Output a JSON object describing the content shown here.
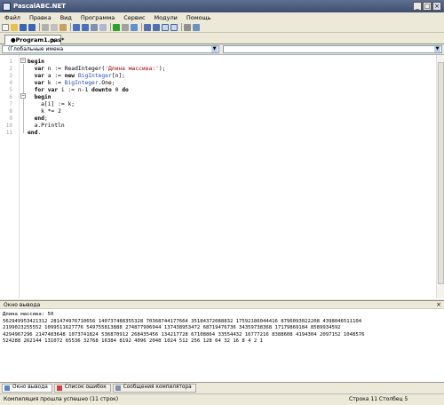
{
  "window": {
    "title": "PascalABC.NET",
    "min": "_",
    "max": "□",
    "close": "×"
  },
  "menu": [
    "Файл",
    "Правка",
    "Вид",
    "Программа",
    "Сервис",
    "Модули",
    "Помощь"
  ],
  "tab": {
    "label": "●Program1.pas*",
    "close": "×"
  },
  "dropdowns": {
    "left": "(Глобальные имена",
    "right": ""
  },
  "editor": {
    "line_numbers": [
      "1",
      "2",
      "3",
      "4",
      "5",
      "6",
      "7",
      "8",
      "9",
      "10",
      "11"
    ],
    "lines": [
      [
        {
          "t": "begin",
          "c": "kw"
        }
      ],
      [
        {
          "t": "  var ",
          "c": "kw"
        },
        {
          "t": "n := ReadInteger(",
          "c": "nm"
        },
        {
          "t": "'Длина массива:'",
          "c": "st"
        },
        {
          "t": ");",
          "c": "nm"
        }
      ],
      [
        {
          "t": "  var ",
          "c": "kw"
        },
        {
          "t": "a := ",
          "c": "nm"
        },
        {
          "t": "new ",
          "c": "kw"
        },
        {
          "t": "BigInteger",
          "c": "ty"
        },
        {
          "t": "[n];",
          "c": "nm"
        }
      ],
      [
        {
          "t": "  var ",
          "c": "kw"
        },
        {
          "t": "k := ",
          "c": "nm"
        },
        {
          "t": "BigInteger",
          "c": "ty"
        },
        {
          "t": ".One;",
          "c": "nm"
        }
      ],
      [
        {
          "t": "  for var ",
          "c": "kw"
        },
        {
          "t": "i := n-1 ",
          "c": "nm"
        },
        {
          "t": "downto ",
          "c": "kw"
        },
        {
          "t": "0 ",
          "c": "nm"
        },
        {
          "t": "do",
          "c": "kw"
        }
      ],
      [
        {
          "t": "  begin",
          "c": "kw"
        }
      ],
      [
        {
          "t": "    a[i] := k;",
          "c": "nm"
        }
      ],
      [
        {
          "t": "    k *= 2",
          "c": "nm"
        }
      ],
      [
        {
          "t": "  end",
          "c": "kw"
        },
        {
          "t": ";",
          "c": "nm"
        }
      ],
      [
        {
          "t": "  a.Println",
          "c": "nm"
        }
      ],
      [
        {
          "t": "end",
          "c": "kw"
        },
        {
          "t": ".",
          "c": "nm"
        }
      ]
    ]
  },
  "output": {
    "header": "Окно вывода",
    "close": "×",
    "text": "Длина массива: 50\n562949953421312 281474976710656 140737488355328 70368744177664 35184372088832 17592186044416 8796093022208 4398046511104\n2199023255552 1099511627776 549755813888 274877906944 137438953472 68719476736 34359738368 17179869184 8589934592\n4294967296 2147483648 1073741824 536870912 268435456 134217728 67108864 33554432 16777216 8388608 4194304 2097152 1048576\n524288 262144 131072 65536 32768 16384 8192 4096 2048 1024 512 256 128 64 32 16 8 4 2 1"
  },
  "bottom_tabs": [
    "Окно вывода",
    "Список ошибок",
    "Сообщения компилятора"
  ],
  "status": {
    "message": "Компиляция прошла успешно (11 строк)",
    "position": "Строка   11  Столбец  5"
  },
  "colors": {
    "keyword": "#000000",
    "string": "#a00000",
    "type": "#1f4fbf",
    "titlebar": "#4f5f7f"
  }
}
